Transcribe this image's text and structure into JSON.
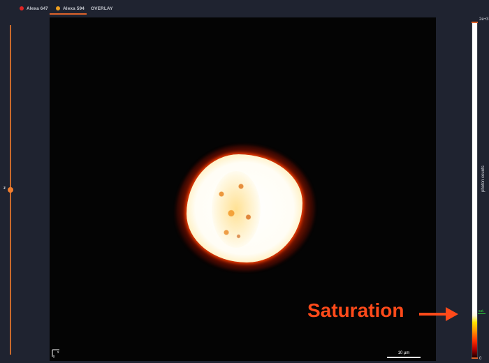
{
  "tabs": [
    {
      "label": "Alexa 647",
      "dot_color": "#e02424"
    },
    {
      "label": "Alexa 594",
      "dot_color": "#f0a020",
      "active": true
    },
    {
      "label": "OVERLAY"
    }
  ],
  "slider": {
    "label": "z"
  },
  "viewer": {
    "scale_bar_label": "10 µm",
    "axis_x": "x",
    "axis_y": "y"
  },
  "colorbar": {
    "max_label": "2e+3",
    "min_label": "0",
    "axis_label": "photon counts",
    "sat_label": "sat.",
    "sat_color": "#2fd43c",
    "colormap": "hot"
  },
  "annotation": {
    "text": "Saturation",
    "color": "#ff4a1a"
  }
}
